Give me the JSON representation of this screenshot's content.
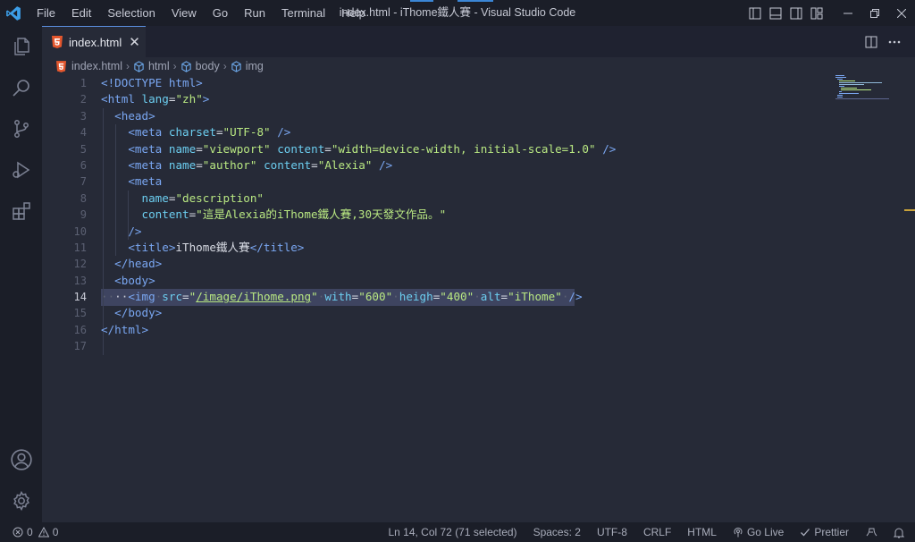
{
  "window": {
    "title": "index.html - iThome鐵人賽 - Visual Studio Code",
    "menu": [
      "File",
      "Edit",
      "Selection",
      "View",
      "Go",
      "Run",
      "Terminal",
      "Help"
    ]
  },
  "tab": {
    "label": "index.html",
    "close": "✕"
  },
  "breadcrumb": {
    "file": "index.html",
    "items": [
      "html",
      "body",
      "img"
    ]
  },
  "editor": {
    "active_line": 14,
    "lines": [
      "1",
      "2",
      "3",
      "4",
      "5",
      "6",
      "7",
      "8",
      "9",
      "10",
      "11",
      "12",
      "13",
      "14",
      "15",
      "16",
      "17"
    ]
  },
  "statusbar": {
    "errors": "0",
    "warnings": "0",
    "position": "Ln 14, Col 72 (71 selected)",
    "spaces": "Spaces: 2",
    "encoding": "UTF-8",
    "eol": "CRLF",
    "language": "HTML",
    "golive": "Go Live",
    "prettier": "Prettier"
  },
  "code": {
    "doctype": "<!DOCTYPE html>",
    "lang_val": "\"zh\"",
    "charset_val": "\"UTF-8\"",
    "viewport_name": "\"viewport\"",
    "viewport_content": "\"width=device-width, initial-scale=1.0\"",
    "author_name": "\"author\"",
    "author_content": "\"Alexia\"",
    "desc_name": "\"description\"",
    "desc_content": "\"這是Alexia的iThome鐵人賽,30天發文作品。\"",
    "title_text": "iThome鐵人賽",
    "img_src": "/image/iThome.png",
    "img_with": "\"600\"",
    "img_heigh": "\"400\"",
    "img_alt": "\"iThome\""
  },
  "colors": {
    "background": "#262a37",
    "chrome": "#1b1e28",
    "tag": "#7aa7f2",
    "attribute": "#6ccef0",
    "string": "#b9e882"
  }
}
